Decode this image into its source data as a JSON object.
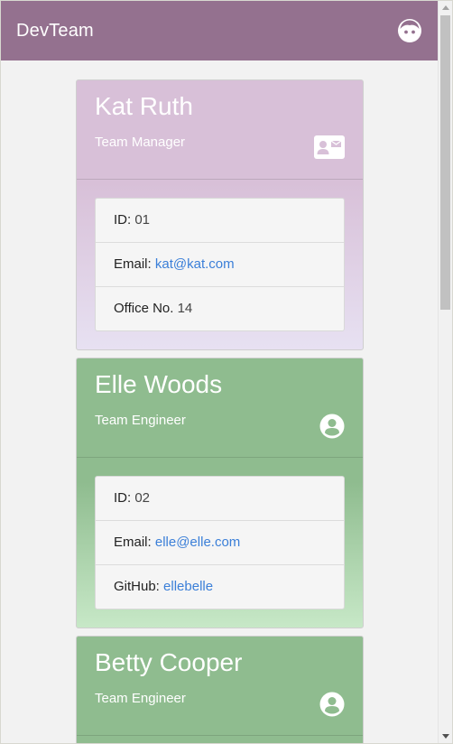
{
  "navbar": {
    "brand": "DevTeam",
    "icon": "face-icon"
  },
  "cards": [
    {
      "name": "Kat Ruth",
      "role": "Team Manager",
      "role_icon": "id-card-icon",
      "accent": "#d8c0d8",
      "details": [
        {
          "label": "ID:",
          "value": "01"
        },
        {
          "label": "Email:",
          "value": "kat@kat.com"
        },
        {
          "label": "Office No.",
          "value": "14"
        }
      ]
    },
    {
      "name": "Elle Woods",
      "role": "Team Engineer",
      "role_icon": "user-circle-icon",
      "accent": "#8fbc8f",
      "details": [
        {
          "label": "ID:",
          "value": "02"
        },
        {
          "label": "Email:",
          "value": "elle@elle.com"
        },
        {
          "label": "GitHub:",
          "value": "ellebelle"
        }
      ]
    },
    {
      "name": "Betty Cooper",
      "role": "Team Engineer",
      "role_icon": "user-circle-icon",
      "accent": "#8fbc8f"
    }
  ],
  "colors": {
    "navbar": "#94718f",
    "link": "#3b7fd8"
  }
}
